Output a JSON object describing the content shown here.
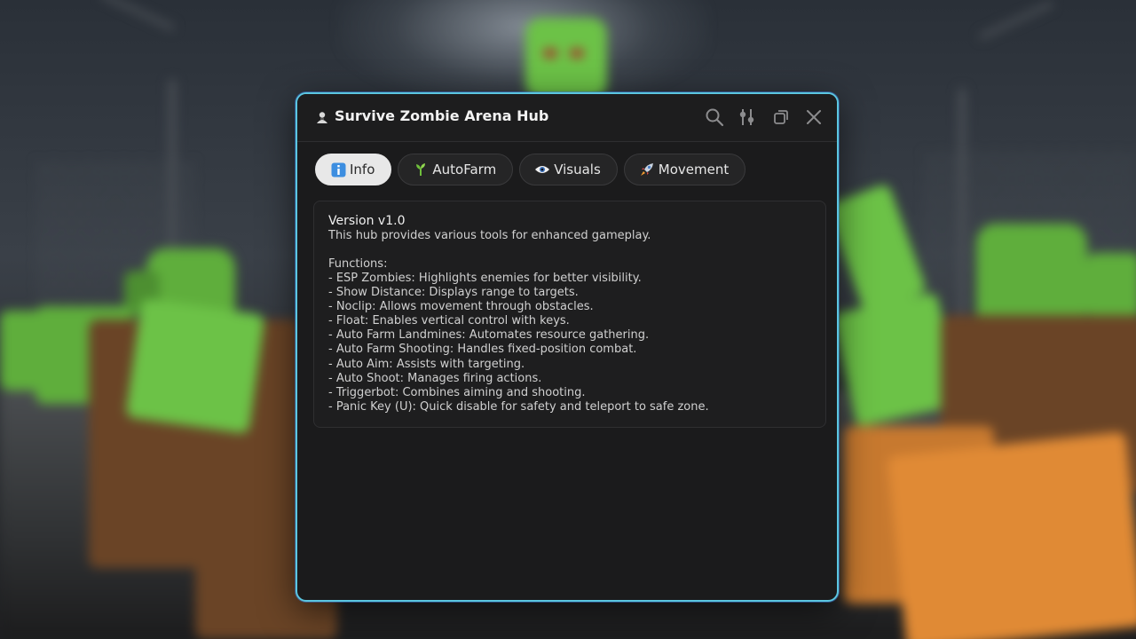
{
  "window": {
    "title": "Survive Zombie Arena Hub",
    "accent_border": "#5bc6e0"
  },
  "titlebar_buttons": [
    {
      "name": "search-icon"
    },
    {
      "name": "settings-sliders-icon"
    },
    {
      "name": "minimize-icon"
    },
    {
      "name": "close-icon"
    }
  ],
  "tabs": [
    {
      "label": "Info",
      "icon": "info-icon",
      "active": true
    },
    {
      "label": "AutoFarm",
      "icon": "sprout-icon",
      "active": false
    },
    {
      "label": "Visuals",
      "icon": "eye-icon",
      "active": false
    },
    {
      "label": "Movement",
      "icon": "rocket-icon",
      "active": false
    }
  ],
  "info": {
    "version": "Version v1.0",
    "description": "This hub provides various tools for enhanced gameplay.",
    "functions_title": "Functions:",
    "functions": [
      "- ESP Zombies: Highlights enemies for better visibility.",
      "- Show Distance: Displays range to targets.",
      "- Noclip: Allows movement through obstacles.",
      "- Float: Enables vertical control with keys.",
      "- Auto Farm Landmines: Automates resource gathering.",
      "- Auto Farm Shooting: Handles fixed-position combat.",
      "- Auto Aim: Assists with targeting.",
      "- Auto Shoot: Manages firing actions.",
      "- Triggerbot: Combines aiming and shooting.",
      "- Panic Key (U): Quick disable for safety and teleport to safe zone."
    ]
  }
}
